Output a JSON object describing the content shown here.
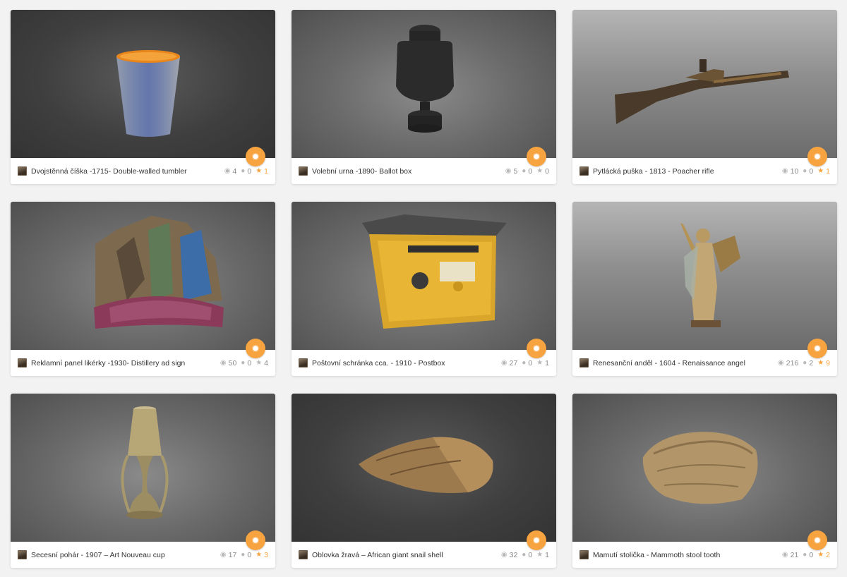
{
  "colors": {
    "accent": "#f7a440",
    "background": "#f2f2f2"
  },
  "icons": {
    "views": "eye-icon",
    "comments": "comment-icon",
    "likes": "star-icon",
    "action": "gear-icon"
  },
  "cards": [
    {
      "title": "Dvojstěnná číška -1715- Double-walled tumbler",
      "views": "4",
      "comments": "0",
      "likes": "1",
      "liked": true
    },
    {
      "title": "Volební urna -1890- Ballot box",
      "views": "5",
      "comments": "0",
      "likes": "0",
      "liked": false
    },
    {
      "title": "Pytlácká puška - 1813 - Poacher rifle",
      "views": "10",
      "comments": "0",
      "likes": "1",
      "liked": true
    },
    {
      "title": "Reklamní panel likérky -1930- Distillery ad sign",
      "views": "50",
      "comments": "0",
      "likes": "4",
      "liked": false
    },
    {
      "title": "Poštovní schránka cca. - 1910 - Postbox",
      "views": "27",
      "comments": "0",
      "likes": "1",
      "liked": false
    },
    {
      "title": "Renesanční anděl - 1604 - Renaissance angel",
      "views": "216",
      "comments": "2",
      "likes": "9",
      "liked": true
    },
    {
      "title": "Secesní pohár - 1907 – Art Nouveau cup",
      "views": "17",
      "comments": "0",
      "likes": "3",
      "liked": true
    },
    {
      "title": "Oblovka žravá – African giant snail shell",
      "views": "32",
      "comments": "0",
      "likes": "1",
      "liked": false
    },
    {
      "title": "Mamutí stolička - Mammoth stool tooth",
      "views": "21",
      "comments": "0",
      "likes": "2",
      "liked": true
    }
  ]
}
